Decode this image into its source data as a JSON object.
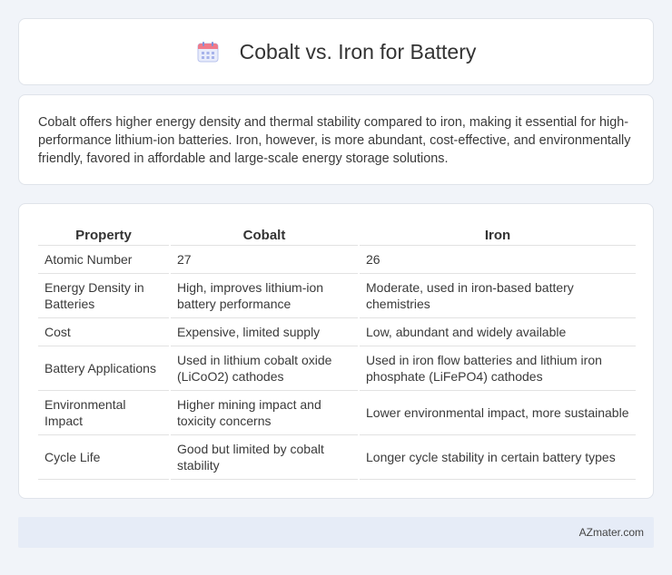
{
  "header": {
    "title": "Cobalt vs. Iron for Battery",
    "icon": "calendar-icon"
  },
  "summary": {
    "text": "Cobalt offers higher energy density and thermal stability compared to iron, making it essential for high-performance lithium-ion batteries. Iron, however, is more abundant, cost-effective, and environmentally friendly, favored in affordable and large-scale energy storage solutions."
  },
  "table": {
    "headers": [
      "Property",
      "Cobalt",
      "Iron"
    ],
    "rows": [
      [
        "Atomic Number",
        "27",
        "26"
      ],
      [
        "Energy Density in Batteries",
        "High, improves lithium-ion battery performance",
        "Moderate, used in iron-based battery chemistries"
      ],
      [
        "Cost",
        "Expensive, limited supply",
        "Low, abundant and widely available"
      ],
      [
        "Battery Applications",
        "Used in lithium cobalt oxide (LiCoO2) cathodes",
        "Used in iron flow batteries and lithium iron phosphate (LiFePO4) cathodes"
      ],
      [
        "Environmental Impact",
        "Higher mining impact and toxicity concerns",
        "Lower environmental impact, more sustainable"
      ],
      [
        "Cycle Life",
        "Good but limited by cobalt stability",
        "Longer cycle stability in certain battery types"
      ]
    ]
  },
  "footer": {
    "text": "AZmater.com"
  }
}
